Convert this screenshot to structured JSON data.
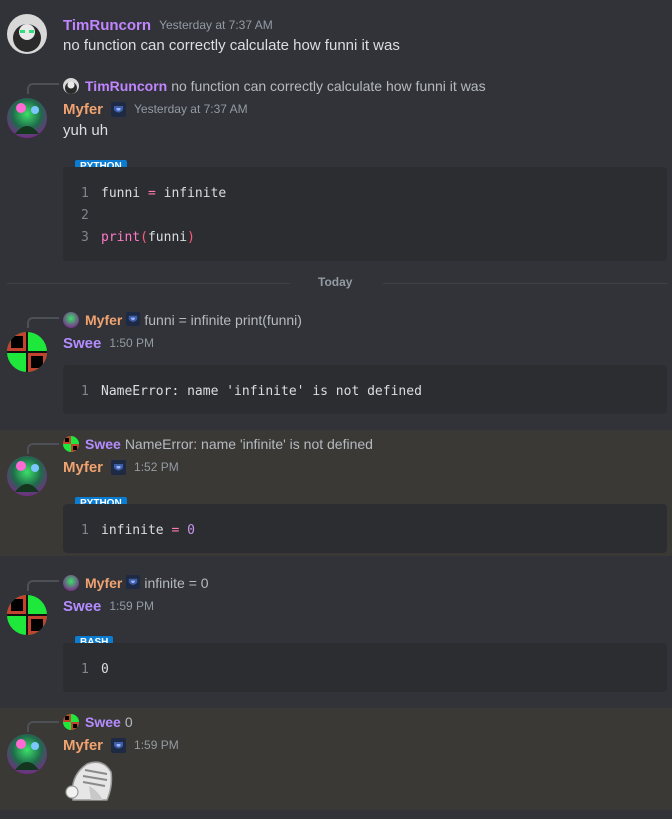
{
  "colors": {
    "tim": "#c186ff",
    "myfer": "#f0a370",
    "swee": "#b48cff",
    "code_bg": "#2b2d31",
    "lang_tag": "#0a7cd1"
  },
  "messages": [
    {
      "author": "TimRuncorn",
      "timestamp": "Yesterday at 7:37 AM",
      "text": "no function can correctly calculate how funni it was"
    },
    {
      "reply_to": {
        "author": "TimRuncorn",
        "text": "no function can correctly calculate how funni it was"
      },
      "author": "Myfer",
      "timestamp": "Yesterday at 7:37 AM",
      "text": "yuh uh",
      "code": {
        "language": "PYTHON",
        "lines": [
          {
            "num": "1",
            "parts": [
              "funni ",
              "=",
              " infinite"
            ]
          },
          {
            "num": "2"
          },
          {
            "num": "3",
            "parts": [
              "print",
              "(",
              "funni",
              ")"
            ]
          }
        ]
      }
    },
    {
      "divider": "Today"
    },
    {
      "reply_to": {
        "author": "Myfer",
        "text": "funni = infinite print(funni)"
      },
      "author": "Swee",
      "timestamp": "1:50 PM",
      "code": {
        "lines": [
          {
            "num": "1",
            "text": "NameError: name 'infinite' is not defined"
          }
        ]
      }
    },
    {
      "reply_to": {
        "author": "Swee",
        "text": "NameError: name 'infinite' is not defined"
      },
      "author": "Myfer",
      "timestamp": "1:52 PM",
      "code": {
        "language": "PYTHON",
        "lines": [
          {
            "num": "1",
            "parts": [
              "infinite ",
              "=",
              " ",
              "0"
            ]
          }
        ]
      }
    },
    {
      "reply_to": {
        "author": "Myfer",
        "text": "infinite = 0"
      },
      "author": "Swee",
      "timestamp": "1:59 PM",
      "code": {
        "language": "BASH",
        "lines": [
          {
            "num": "1",
            "text": "0"
          }
        ]
      }
    },
    {
      "reply_to": {
        "author": "Swee",
        "text": "0"
      },
      "author": "Myfer",
      "timestamp": "1:59 PM",
      "sticker": "knight-helmet-sticker"
    }
  ]
}
